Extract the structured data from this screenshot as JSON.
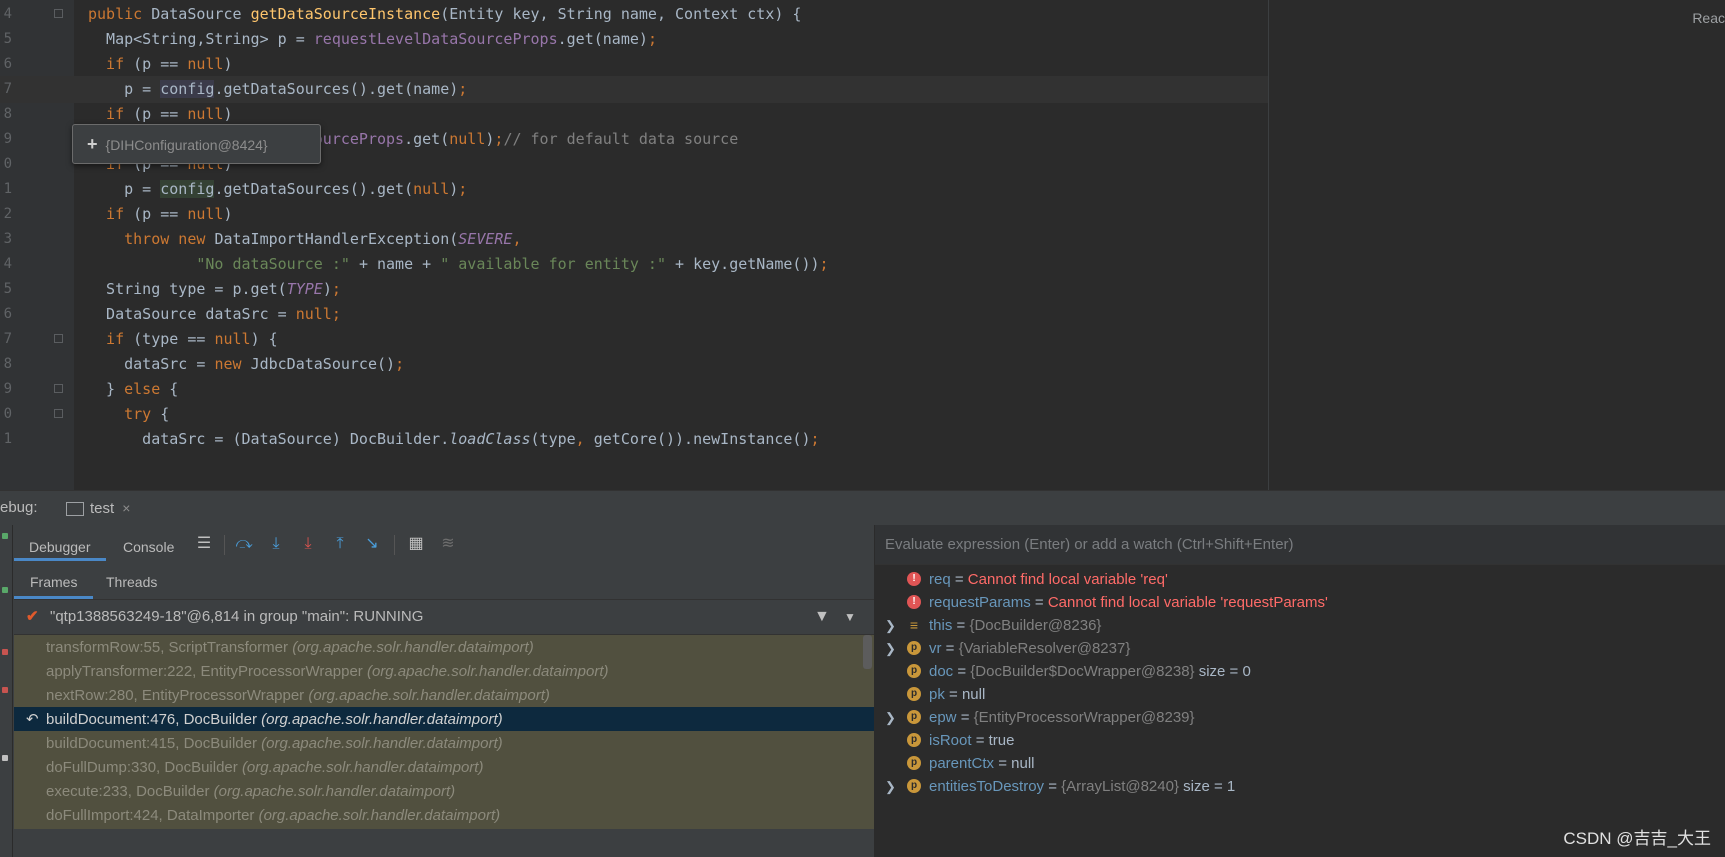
{
  "editor": {
    "reader_mode_label": "Reac",
    "lines": [
      {
        "num": "4",
        "tokens": [
          [
            "kw",
            "public "
          ],
          [
            "pl",
            "DataSource "
          ],
          [
            "fn",
            "getDataSourceInstance"
          ],
          [
            "pl",
            "(Entity key, String name, Context ctx) {"
          ]
        ]
      },
      {
        "num": "5",
        "tokens": [
          [
            "pl",
            "  Map<String,String> p = "
          ],
          [
            "fld",
            "requestLevelDataSourceProps"
          ],
          [
            "pl",
            ".get(name)"
          ],
          [
            "kw",
            ";"
          ]
        ]
      },
      {
        "num": "6",
        "tokens": [
          [
            "kw",
            "  if "
          ],
          [
            "pl",
            "(p == "
          ],
          [
            "kw",
            "null"
          ],
          [
            "pl",
            ")"
          ]
        ]
      },
      {
        "num": "7",
        "tokens": [
          [
            "pl",
            "    p = "
          ],
          [
            "hlb",
            "config"
          ],
          [
            "pl",
            ".getDataSources().get(name)"
          ],
          [
            "kw",
            ";"
          ]
        ]
      },
      {
        "num": "8",
        "tokens": [
          [
            "kw",
            "  if "
          ],
          [
            "pl",
            "(p == "
          ],
          [
            "kw",
            "null"
          ],
          [
            "pl",
            ")"
          ]
        ]
      },
      {
        "num": "9",
        "tokens": [
          [
            "pl",
            "    p = "
          ],
          [
            "fld",
            "requestLevelDataSourceProps"
          ],
          [
            "pl",
            ".get("
          ],
          [
            "kw",
            "null"
          ],
          [
            "pl",
            ")"
          ],
          [
            "kw",
            ";"
          ],
          [
            "cmt",
            "// for default data source"
          ]
        ]
      },
      {
        "num": "0",
        "tokens": [
          [
            "kw",
            "  if "
          ],
          [
            "pl",
            "(p == "
          ],
          [
            "kw",
            "null"
          ],
          [
            "pl",
            ")"
          ]
        ]
      },
      {
        "num": "1",
        "tokens": [
          [
            "pl",
            "    p = "
          ],
          [
            "hl",
            "config"
          ],
          [
            "pl",
            ".getDataSources().get("
          ],
          [
            "kw",
            "null"
          ],
          [
            "pl",
            ")"
          ],
          [
            "kw",
            ";"
          ]
        ]
      },
      {
        "num": "2",
        "tokens": [
          [
            "kw",
            "  if "
          ],
          [
            "pl",
            "(p == "
          ],
          [
            "kw",
            "null"
          ],
          [
            "pl",
            ")"
          ]
        ]
      },
      {
        "num": "3",
        "tokens": [
          [
            "kw",
            "    throw new "
          ],
          [
            "pl",
            "DataImportHandlerException("
          ],
          [
            "cst",
            "SEVERE"
          ],
          [
            "kw",
            ","
          ]
        ]
      },
      {
        "num": "4",
        "tokens": [
          [
            "str",
            "            \"No dataSource :\" "
          ],
          [
            "pl",
            "+ name + "
          ],
          [
            "str",
            "\" available for entity :\" "
          ],
          [
            "pl",
            "+ key.getName())"
          ],
          [
            "kw",
            ";"
          ]
        ]
      },
      {
        "num": "5",
        "tokens": [
          [
            "pl",
            "  String type = p.get("
          ],
          [
            "cst",
            "TYPE"
          ],
          [
            "pl",
            ")"
          ],
          [
            "kw",
            ";"
          ]
        ]
      },
      {
        "num": "6",
        "tokens": [
          [
            "pl",
            "  DataSource dataSrc = "
          ],
          [
            "kw",
            "null;"
          ]
        ]
      },
      {
        "num": "7",
        "tokens": [
          [
            "kw",
            "  if "
          ],
          [
            "pl",
            "(type == "
          ],
          [
            "kw",
            "null"
          ],
          [
            "pl",
            ") {"
          ]
        ]
      },
      {
        "num": "8",
        "tokens": [
          [
            "pl",
            "    dataSrc = "
          ],
          [
            "kw",
            "new "
          ],
          [
            "pl",
            "JdbcDataSource()"
          ],
          [
            "kw",
            ";"
          ]
        ]
      },
      {
        "num": "9",
        "tokens": [
          [
            "pl",
            "  } "
          ],
          [
            "kw",
            "else "
          ],
          [
            "pl",
            "{"
          ]
        ]
      },
      {
        "num": "0",
        "tokens": [
          [
            "kw",
            "    try "
          ],
          [
            "pl",
            "{"
          ]
        ]
      },
      {
        "num": "1",
        "tokens": [
          [
            "pl",
            "      dataSrc = (DataSource) DocBuilder."
          ],
          [
            "st",
            "loadClass"
          ],
          [
            "pl",
            "(type"
          ],
          [
            "kw",
            ", "
          ],
          [
            "pl",
            "getCore()).newInstance()"
          ],
          [
            "kw",
            ";"
          ]
        ]
      }
    ],
    "tooltip": {
      "plus": "+",
      "text": "{DIHConfiguration@8424}"
    }
  },
  "debug": {
    "label": "ebug:",
    "run_tab": "test",
    "close": "×",
    "tabs": {
      "debugger": "Debugger",
      "console": "Console"
    },
    "subtabs": {
      "frames": "Frames",
      "threads": "Threads"
    },
    "thread": "\"qtp1388563249-18\"@6,814 in group \"main\": RUNNING",
    "frames": [
      {
        "method": "transformRow:55, ScriptTransformer ",
        "pkg": "(org.apache.solr.handler.dataimport)"
      },
      {
        "method": "applyTransformer:222, EntityProcessorWrapper ",
        "pkg": "(org.apache.solr.handler.dataimport)"
      },
      {
        "method": "nextRow:280, EntityProcessorWrapper ",
        "pkg": "(org.apache.solr.handler.dataimport)"
      },
      {
        "method": "buildDocument:476, DocBuilder ",
        "pkg": "(org.apache.solr.handler.dataimport)"
      },
      {
        "method": "buildDocument:415, DocBuilder ",
        "pkg": "(org.apache.solr.handler.dataimport)"
      },
      {
        "method": "doFullDump:330, DocBuilder ",
        "pkg": "(org.apache.solr.handler.dataimport)"
      },
      {
        "method": "execute:233, DocBuilder ",
        "pkg": "(org.apache.solr.handler.dataimport)"
      },
      {
        "method": "doFullImport:424, DataImporter ",
        "pkg": "(org.apache.solr.handler.dataimport)"
      }
    ],
    "selected_frame_index": 3,
    "eval_placeholder": "Evaluate expression (Enter) or add a watch (Ctrl+Shift+Enter)",
    "variables": [
      {
        "expand": "",
        "icon": "err",
        "name": "req",
        "eq": " = ",
        "value": "Cannot find local variable 'req'",
        "obj": "",
        "extra": ""
      },
      {
        "expand": "",
        "icon": "err",
        "name": "requestParams",
        "eq": " = ",
        "value": "Cannot find local variable 'requestParams'",
        "obj": "",
        "extra": ""
      },
      {
        "expand": ">",
        "icon": "this",
        "name": "this",
        "eq": " = ",
        "value": "",
        "obj": "{DocBuilder@8236}",
        "extra": ""
      },
      {
        "expand": ">",
        "icon": "p",
        "name": "vr",
        "eq": " = ",
        "value": "",
        "obj": "{VariableResolver@8237}",
        "extra": ""
      },
      {
        "expand": "",
        "icon": "p",
        "name": "doc",
        "eq": " = ",
        "value": "",
        "obj": "{DocBuilder$DocWrapper@8238}",
        "extra": "  size = 0"
      },
      {
        "expand": "",
        "icon": "p",
        "name": "pk",
        "eq": " = ",
        "value": "null",
        "obj": "",
        "extra": ""
      },
      {
        "expand": ">",
        "icon": "p",
        "name": "epw",
        "eq": " = ",
        "value": "",
        "obj": "{EntityProcessorWrapper@8239}",
        "extra": ""
      },
      {
        "expand": "",
        "icon": "p",
        "name": "isRoot",
        "eq": " = ",
        "value": "true",
        "obj": "",
        "extra": ""
      },
      {
        "expand": "",
        "icon": "p",
        "name": "parentCtx",
        "eq": " = ",
        "value": "null",
        "obj": "",
        "extra": ""
      },
      {
        "expand": ">",
        "icon": "p",
        "name": "entitiesToDestroy",
        "eq": " = ",
        "value": "",
        "obj": "{ArrayList@8240}",
        "extra": "  size = 1"
      }
    ],
    "watermark": "CSDN @吉吉_大王"
  },
  "colors": {
    "editor_bg": "#2b2b2b",
    "panel_bg": "#3c3f41",
    "keyword": "#cc7832",
    "method": "#ffc66d",
    "field": "#9876aa",
    "string": "#6a8759",
    "comment": "#808080",
    "error": "#ff6b68",
    "var_name": "#6897bb",
    "selected_frame": "#0d293e",
    "frame_bg": "#51503f",
    "accent": "#4a88c7"
  }
}
